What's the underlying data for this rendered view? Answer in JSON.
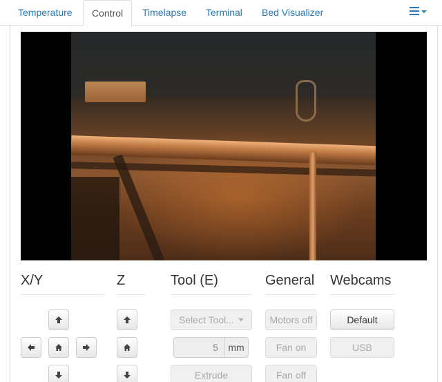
{
  "tabs": [
    {
      "label": "Temperature",
      "active": false
    },
    {
      "label": "Control",
      "active": true
    },
    {
      "label": "Timelapse",
      "active": false
    },
    {
      "label": "Terminal",
      "active": false
    },
    {
      "label": "Bed Visualizer",
      "active": false
    }
  ],
  "tab_menu_icon": "list-icon",
  "sections": {
    "xy": {
      "title": "X/Y"
    },
    "z": {
      "title": "Z"
    },
    "tool": {
      "title": "Tool (E)",
      "select_tool_label": "Select Tool...",
      "amount_value": "5",
      "amount_unit": "mm",
      "extrude_label": "Extrude"
    },
    "general": {
      "title": "General",
      "motors_off_label": "Motors off",
      "fan_on_label": "Fan on",
      "fan_off_label": "Fan off"
    },
    "webcams": {
      "title": "Webcams",
      "default_label": "Default",
      "usb_label": "USB"
    }
  },
  "colors": {
    "link": "#2a7ab0",
    "text": "#333333",
    "border": "#dddddd"
  }
}
